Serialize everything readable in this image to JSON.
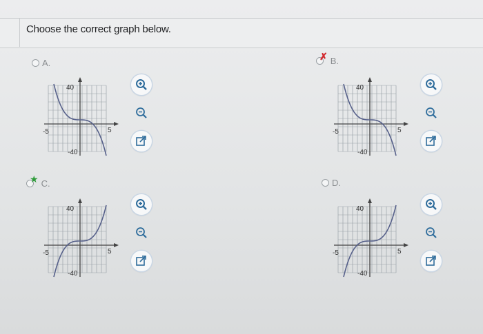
{
  "question": "Choose the correct graph below.",
  "options": [
    {
      "letter": "A.",
      "mark": "",
      "tick_top": "40",
      "tick_bottom": "-40",
      "tick_left": "-5",
      "tick_right": "5"
    },
    {
      "letter": "B.",
      "mark": "✗",
      "tick_top": "40",
      "tick_bottom": "-40",
      "tick_left": "-5",
      "tick_right": "5"
    },
    {
      "letter": "C.",
      "mark": "★",
      "tick_top": "40",
      "tick_bottom": "-40",
      "tick_left": "-5",
      "tick_right": "5"
    },
    {
      "letter": "D.",
      "mark": "",
      "tick_top": "40",
      "tick_bottom": "-40",
      "tick_left": "-5",
      "tick_right": "5"
    }
  ],
  "colors": {
    "curve": "#56608a",
    "grid": "#9aa2a8",
    "wrong": "#d2262c",
    "correct": "#2e9b3a",
    "tool_icon": "#2f6d9c"
  },
  "icons": [
    "zoom-in-icon",
    "zoom-out-icon",
    "open-window-icon"
  ]
}
